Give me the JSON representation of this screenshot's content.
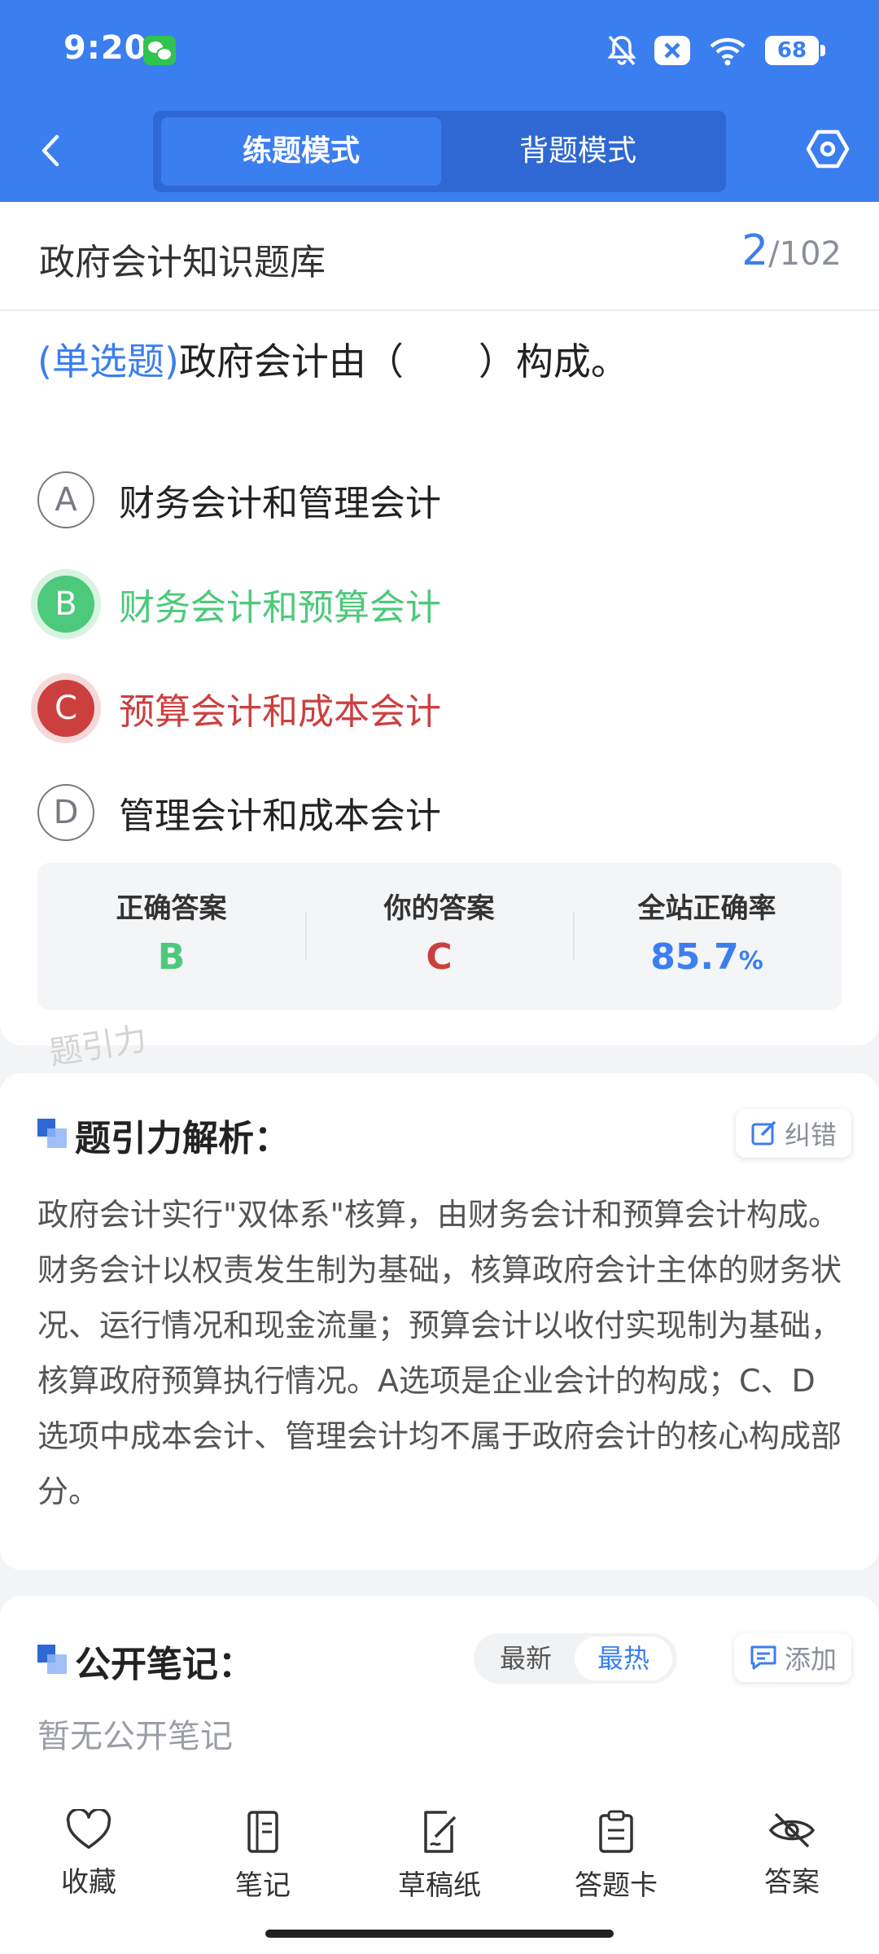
{
  "status_bar": {
    "time": "9:20",
    "battery": "68"
  },
  "header": {
    "tabs": [
      {
        "label": "练题模式",
        "active": true
      },
      {
        "label": "背题模式",
        "active": false
      }
    ]
  },
  "question": {
    "bank_title": "政府会计知识题库",
    "progress_current": "2",
    "progress_total": "/102",
    "type_label": "(单选题)",
    "text": "政府会计由（　　）构成。",
    "options": [
      {
        "letter": "A",
        "text": "财务会计和管理会计",
        "state": "normal"
      },
      {
        "letter": "B",
        "text": "财务会计和预算会计",
        "state": "correct"
      },
      {
        "letter": "C",
        "text": "预算会计和成本会计",
        "state": "wrong"
      },
      {
        "letter": "D",
        "text": "管理会计和成本会计",
        "state": "normal"
      }
    ],
    "stats": {
      "correct_label": "正确答案",
      "correct_value": "B",
      "yours_label": "你的答案",
      "yours_value": "C",
      "rate_label": "全站正确率",
      "rate_value": "85.7",
      "rate_unit": "%"
    },
    "watermark": "题引力"
  },
  "analysis": {
    "title": "题引力解析：",
    "report_label": "纠错",
    "text": "政府会计实行\"双体系\"核算，由财务会计和预算会计构成。财务会计以权责发生制为基础，核算政府会计主体的财务状况、运行情况和现金流量；预算会计以收付实现制为基础，核算政府预算执行情况。A选项是企业会计的构成；C、D选项中成本会计、管理会计均不属于政府会计的核心构成部分。"
  },
  "notes": {
    "title": "公开笔记：",
    "sort_latest": "最新",
    "sort_hot": "最热",
    "add_label": "添加",
    "empty_text": "暂无公开笔记"
  },
  "bottom_nav": [
    {
      "label": "收藏",
      "icon": "heart-icon"
    },
    {
      "label": "笔记",
      "icon": "notebook-icon"
    },
    {
      "label": "草稿纸",
      "icon": "draft-icon"
    },
    {
      "label": "答题卡",
      "icon": "clipboard-icon"
    },
    {
      "label": "答案",
      "icon": "eye-off-icon"
    }
  ],
  "colors": {
    "primary": "#3b7ef0",
    "correct": "#4cc97a",
    "wrong": "#cc3f3f"
  }
}
